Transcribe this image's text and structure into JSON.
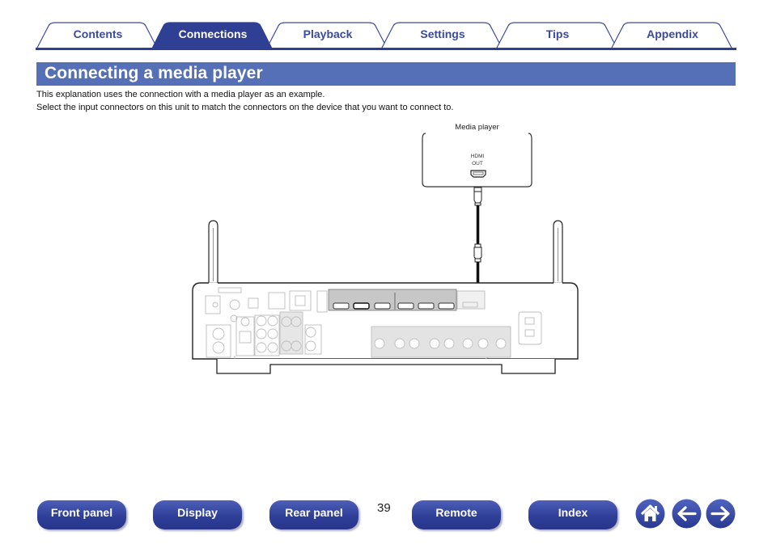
{
  "tabs": [
    {
      "label": "Contents",
      "active": false
    },
    {
      "label": "Connections",
      "active": true
    },
    {
      "label": "Playback",
      "active": false
    },
    {
      "label": "Settings",
      "active": false
    },
    {
      "label": "Tips",
      "active": false
    },
    {
      "label": "Appendix",
      "active": false
    }
  ],
  "colors": {
    "tab_active": "#2f3f94",
    "tab_border": "#3b4a9c",
    "header_bg": "#5670b8",
    "nav_button": "#2f3f98"
  },
  "section": {
    "title": "Connecting a media player",
    "intro": [
      "This explanation uses the connection with a media player as an example.",
      "Select the input connectors on this unit to match the connectors on the device that you want to connect to."
    ]
  },
  "diagram": {
    "device_label": "Media player",
    "port_label_line1": "HDMI",
    "port_label_line2": "OUT",
    "cable": "HDMI cable"
  },
  "footer": {
    "buttons": [
      {
        "label": "Front panel"
      },
      {
        "label": "Display"
      },
      {
        "label": "Rear panel"
      },
      {
        "label": "Remote"
      },
      {
        "label": "Index"
      }
    ],
    "page_number": "39",
    "icons": [
      "home-icon",
      "back-arrow-icon",
      "forward-arrow-icon"
    ]
  }
}
